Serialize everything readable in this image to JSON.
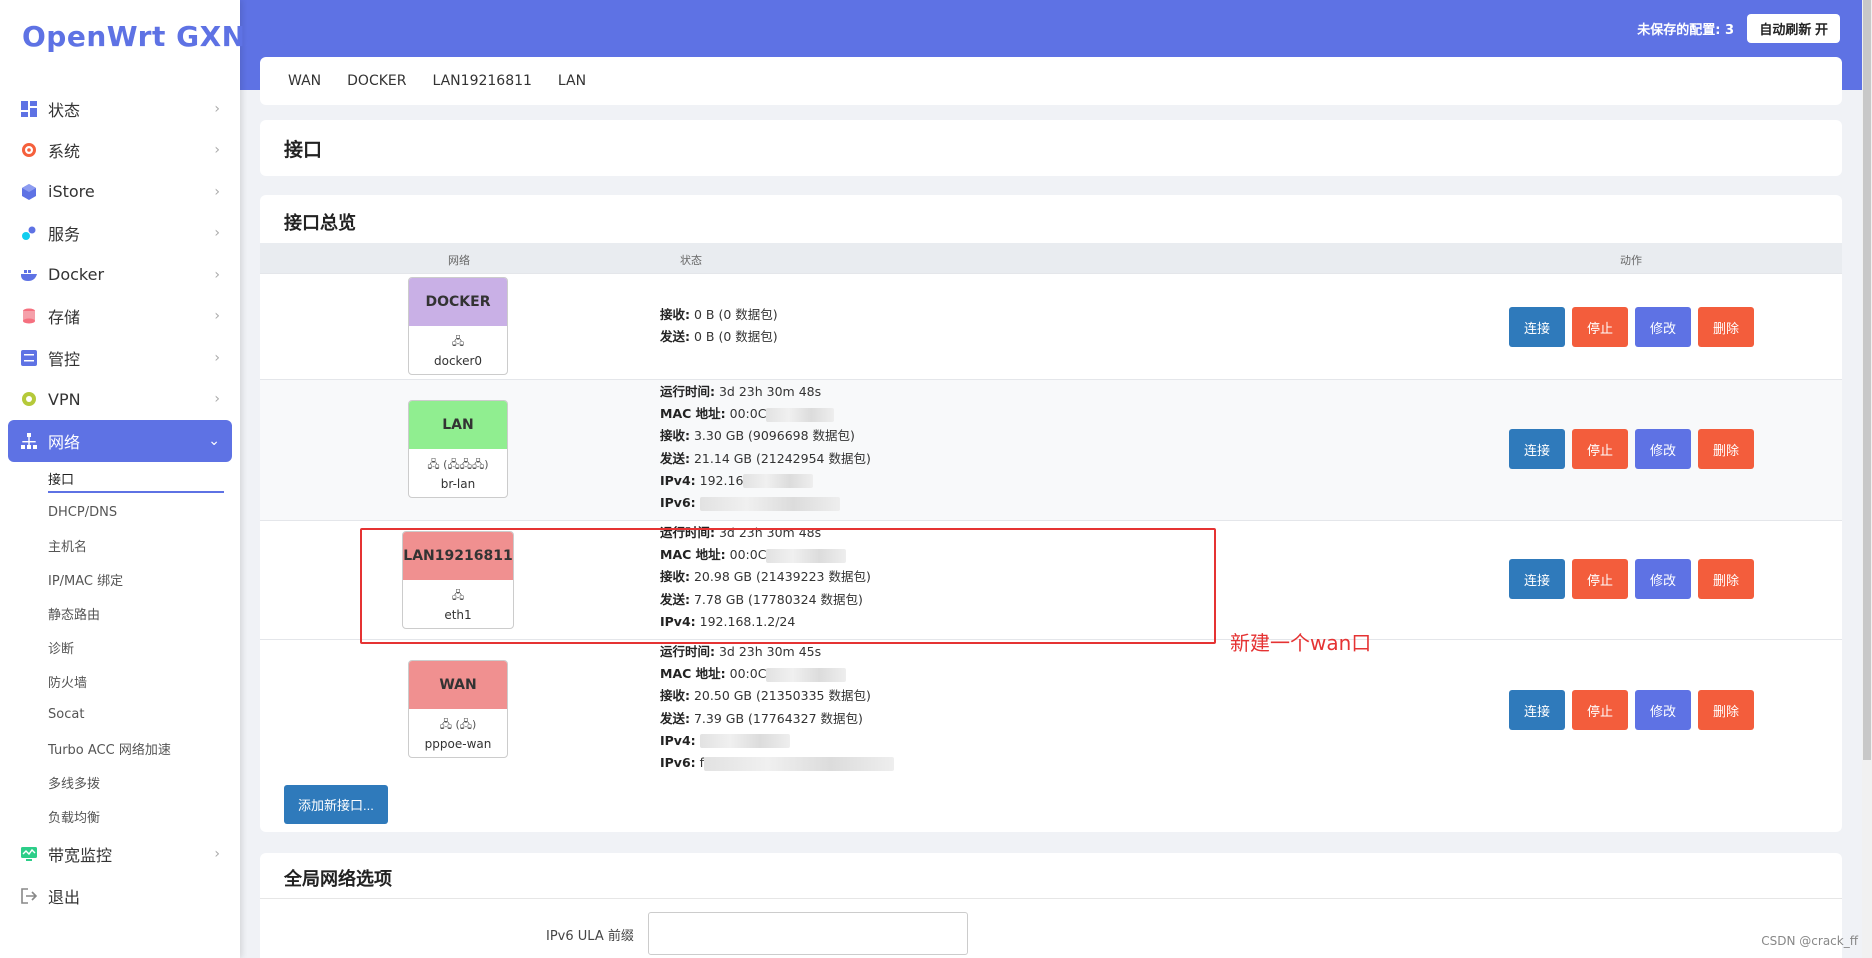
{
  "app": {
    "logo": "OpenWrt GXNAS"
  },
  "topbar": {
    "unsaved": "未保存的配置: 3",
    "autorefresh": "自动刷新 开"
  },
  "sidebar": {
    "items": [
      {
        "label": "状态",
        "icon": "dashboard-icon"
      },
      {
        "label": "系统",
        "icon": "gear-icon"
      },
      {
        "label": "iStore",
        "icon": "cube-icon"
      },
      {
        "label": "服务",
        "icon": "puzzle-icon"
      },
      {
        "label": "Docker",
        "icon": "docker-whale-icon"
      },
      {
        "label": "存储",
        "icon": "database-icon"
      },
      {
        "label": "管控",
        "icon": "sliders-icon"
      },
      {
        "label": "VPN",
        "icon": "vpn-icon"
      },
      {
        "label": "网络",
        "icon": "network-icon"
      }
    ],
    "network_sub": [
      "接口",
      "DHCP/DNS",
      "主机名",
      "IP/MAC 绑定",
      "静态路由",
      "诊断",
      "防火墙",
      "Socat",
      "Turbo ACC 网络加速",
      "多线多拨",
      "负载均衡"
    ],
    "bottom_items": [
      {
        "label": "带宽监控",
        "icon": "monitor-icon"
      },
      {
        "label": "退出",
        "icon": "logout-icon"
      }
    ]
  },
  "tabs": [
    "WAN",
    "DOCKER",
    "LAN19216811",
    "LAN"
  ],
  "page_title": "接口",
  "overview": {
    "title": "接口总览",
    "headers": {
      "network": "网络",
      "status": "状态",
      "actions": "动作"
    },
    "interfaces": [
      {
        "name": "DOCKER",
        "device": "docker0",
        "color": "#c9b0e6",
        "status": [
          {
            "k": "接收:",
            "v": "0 B (0 数据包)"
          },
          {
            "k": "发送:",
            "v": "0 B (0 数据包)"
          }
        ]
      },
      {
        "name": "LAN",
        "device": "br-lan",
        "color": "#90ee90",
        "status": [
          {
            "k": "运行时间:",
            "v": "3d 23h 30m 48s"
          },
          {
            "k": "MAC 地址:",
            "v": "00:0C"
          },
          {
            "k": "接收:",
            "v": "3.30 GB (9096698 数据包)"
          },
          {
            "k": "发送:",
            "v": "21.14 GB (21242954 数据包)"
          },
          {
            "k": "IPv4:",
            "v": "192.16"
          },
          {
            "k": "IPv6:",
            "v": ""
          }
        ]
      },
      {
        "name": "LAN19216811",
        "device": "eth1",
        "color": "#f09090",
        "status": [
          {
            "k": "运行时间:",
            "v": "3d 23h 30m 48s"
          },
          {
            "k": "MAC 地址:",
            "v": "00:0C"
          },
          {
            "k": "接收:",
            "v": "20.98 GB (21439223 数据包)"
          },
          {
            "k": "发送:",
            "v": "7.78 GB (17780324 数据包)"
          },
          {
            "k": "IPv4:",
            "v": "192.168.1.2/24"
          }
        ]
      },
      {
        "name": "WAN",
        "device": "pppoe-wan",
        "color": "#f09090",
        "status": [
          {
            "k": "运行时间:",
            "v": "3d 23h 30m 45s"
          },
          {
            "k": "MAC 地址:",
            "v": "00:0C"
          },
          {
            "k": "接收:",
            "v": "20.50 GB (21350335 数据包)"
          },
          {
            "k": "发送:",
            "v": "7.39 GB (17764327 数据包)"
          },
          {
            "k": "IPv4:",
            "v": ""
          },
          {
            "k": "IPv6:",
            "v": "f"
          }
        ]
      }
    ],
    "actions": {
      "connect": "连接",
      "stop": "停止",
      "edit": "修改",
      "delete": "删除"
    },
    "add_button": "添加新接口..."
  },
  "annotation": "新建一个wan口",
  "global": {
    "title": "全局网络选项",
    "ula_label": "IPv6 ULA 前缀",
    "ula_value": ""
  },
  "watermark": "CSDN @crack_ff",
  "colors": {
    "accent": "#5e72e4",
    "connect": "#2f7abb",
    "danger": "#f35d3c",
    "highlight": "#e53333"
  }
}
